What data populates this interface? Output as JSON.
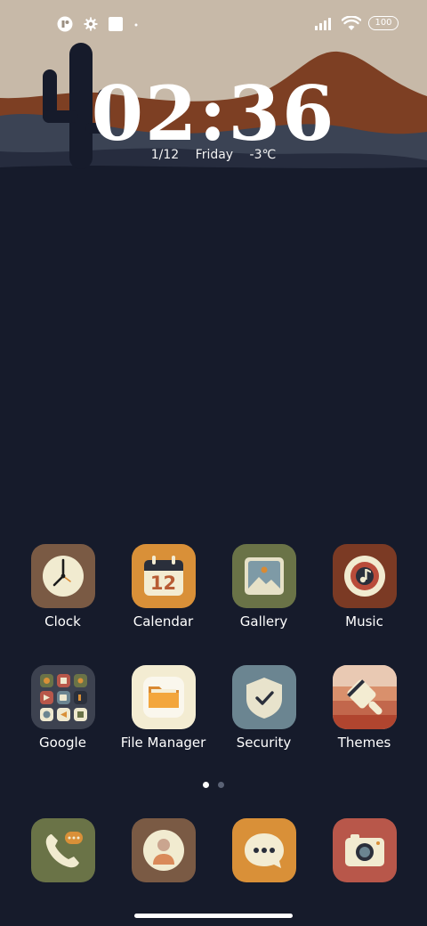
{
  "status_bar": {
    "battery_level": "100",
    "left_icons": [
      "app-notification-icon",
      "settings-gear-icon",
      "square-notification-icon",
      "dot-icon"
    ],
    "right_icons": [
      "signal-bars-icon",
      "wifi-icon",
      "battery-icon"
    ]
  },
  "clock_widget": {
    "time": "02:36",
    "date": "1/12",
    "weekday": "Friday",
    "temperature": "-3℃"
  },
  "apps_row1": [
    {
      "label": "Clock",
      "icon": "clock-icon"
    },
    {
      "label": "Calendar",
      "icon": "calendar-icon",
      "badge_text": "12"
    },
    {
      "label": "Gallery",
      "icon": "gallery-icon"
    },
    {
      "label": "Music",
      "icon": "music-icon"
    }
  ],
  "apps_row2": [
    {
      "label": "Google",
      "icon": "google-folder-icon"
    },
    {
      "label": "File Manager",
      "icon": "folder-icon"
    },
    {
      "label": "Security",
      "icon": "shield-check-icon"
    },
    {
      "label": "Themes",
      "icon": "paintbrush-icon"
    }
  ],
  "dock": [
    {
      "name": "phone",
      "icon": "phone-icon"
    },
    {
      "name": "contacts",
      "icon": "contacts-icon"
    },
    {
      "name": "messages",
      "icon": "message-icon"
    },
    {
      "name": "camera",
      "icon": "camera-icon"
    }
  ],
  "page_indicator": {
    "pages": 2,
    "current": 1
  },
  "colors": {
    "background": "#161b2b",
    "sky": "#c5b8a8",
    "mountain": "#8a4a2e",
    "clock_tile": "#7a5a44",
    "calendar_tile": "#d99038",
    "gallery_tile": "#6a7347",
    "music_tile": "#7b3a24",
    "security_tile": "#6b8591",
    "phone_tile": "#6a7347",
    "camera_tile": "#b8574a"
  }
}
